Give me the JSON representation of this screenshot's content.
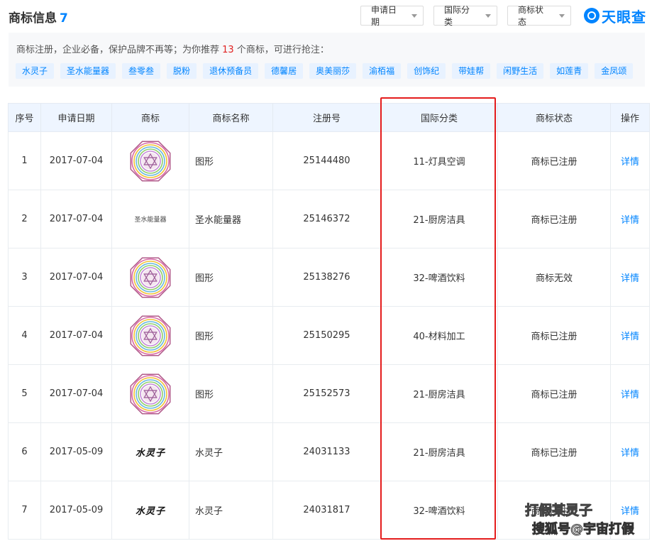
{
  "header": {
    "title": "商标信息",
    "count": "7",
    "filters": [
      "申请日期",
      "国际分类",
      "商标状态"
    ],
    "logo_text": "天眼查"
  },
  "recommend": {
    "prefix": "商标注册，企业必备，保护品牌不再等；为你推荐 ",
    "number": "13",
    "suffix": " 个商标，可进行抢注：",
    "tags": [
      "水灵子",
      "圣水能量器",
      "叁零叁",
      "脱粉",
      "退休预备员",
      "德馨居",
      "奥美丽莎",
      "渝栢福",
      "创饰纪",
      "带娃帮",
      "闲野生活",
      "如莲青",
      "金凤颂"
    ]
  },
  "table": {
    "headers": [
      "序号",
      "申请日期",
      "商标",
      "商标名称",
      "注册号",
      "国际分类",
      "商标状态",
      "操作"
    ],
    "rows": [
      {
        "index": "1",
        "date": "2017-07-04",
        "logo_type": "graphic",
        "logo_text": "",
        "name": "图形",
        "reg_no": "25144480",
        "category": "11-灯具空调",
        "status": "商标已注册",
        "action": "详情"
      },
      {
        "index": "2",
        "date": "2017-07-04",
        "logo_type": "text",
        "logo_text": "圣水能量器",
        "name": "圣水能量器",
        "reg_no": "25146372",
        "category": "21-厨房洁具",
        "status": "商标已注册",
        "action": "详情"
      },
      {
        "index": "3",
        "date": "2017-07-04",
        "logo_type": "graphic",
        "logo_text": "",
        "name": "图形",
        "reg_no": "25138276",
        "category": "32-啤酒饮料",
        "status": "商标无效",
        "action": "详情"
      },
      {
        "index": "4",
        "date": "2017-07-04",
        "logo_type": "graphic",
        "logo_text": "",
        "name": "图形",
        "reg_no": "25150295",
        "category": "40-材料加工",
        "status": "商标已注册",
        "action": "详情"
      },
      {
        "index": "5",
        "date": "2017-07-04",
        "logo_type": "graphic",
        "logo_text": "",
        "name": "图形",
        "reg_no": "25152573",
        "category": "21-厨房洁具",
        "status": "商标已注册",
        "action": "详情"
      },
      {
        "index": "6",
        "date": "2017-05-09",
        "logo_type": "script",
        "logo_text": "水灵子",
        "name": "水灵子",
        "reg_no": "24031133",
        "category": "21-厨房洁具",
        "status": "商标已注册",
        "action": "详情"
      },
      {
        "index": "7",
        "date": "2017-05-09",
        "logo_type": "script",
        "logo_text": "水灵子",
        "name": "水灵子",
        "reg_no": "24031817",
        "category": "32-啤酒饮料",
        "status": "商标已注册",
        "action": "详情"
      }
    ]
  },
  "watermark": {
    "line1": "打假某灵子",
    "line2": "搜狐号@宇宙打假"
  },
  "colors": {
    "accent": "#0084ff",
    "highlight_border": "#e41c1c",
    "header_bg": "#eef5ff",
    "tag_bg": "#e8f2ff"
  },
  "icons": {
    "caret": "chevron-down-icon",
    "logo": "tianyancha-logo-icon"
  }
}
